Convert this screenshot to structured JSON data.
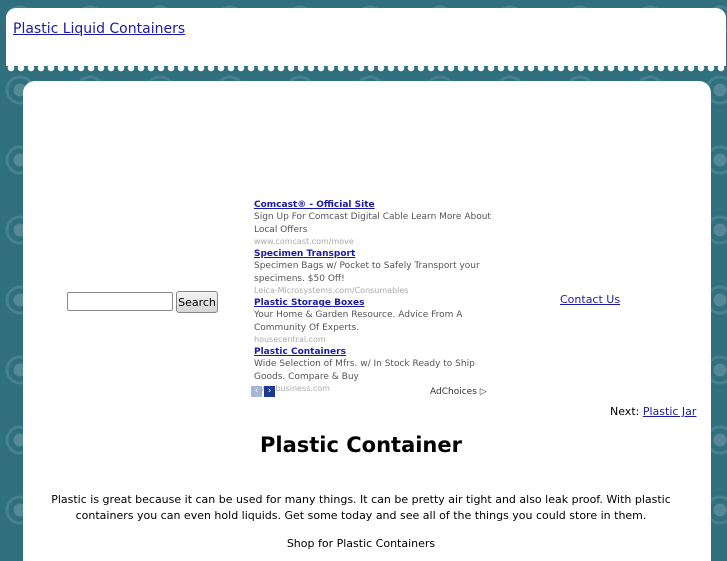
{
  "header": {
    "site_title": "Plastic Liquid Containers"
  },
  "search": {
    "input_value": "",
    "button_label": "Search"
  },
  "ads": [
    {
      "title": "Comcast® - Official Site",
      "description": "Sign Up For Comcast Digital Cable Learn More About Local Offers",
      "url": "www.comcast.com/move"
    },
    {
      "title": "Specimen Transport",
      "description": "Specimen Bags w/ Pocket to Safely Transport your specimens. $50 Off!",
      "url": "Leica-Microsystems.com/Consumables"
    },
    {
      "title": "Plastic Storage Boxes",
      "description": "Your Home & Garden Resource. Advice From A Community Of Experts.",
      "url": "housecentral.com"
    },
    {
      "title": "Plastic Containers",
      "description": "Wide Selection of Mfrs. w/ In Stock Ready to Ship Goods. Compare & Buy",
      "url": "www.business.com"
    }
  ],
  "ad_nav": {
    "prev_icon": "‹",
    "next_icon": "›"
  },
  "adchoices_label": "AdChoices ▷",
  "contact_label": "Contact Us",
  "next_nav": {
    "prefix": "Next:",
    "link": "Plastic Jar"
  },
  "article": {
    "heading": "Plastic Container",
    "intro": "Plastic is great because it can be used for many things. It can be pretty air tight and also leak proof. With plastic containers you can even hold liquids. Get some today and see all of the things you could store in them.",
    "shop_line": "Shop for Plastic Containers"
  }
}
